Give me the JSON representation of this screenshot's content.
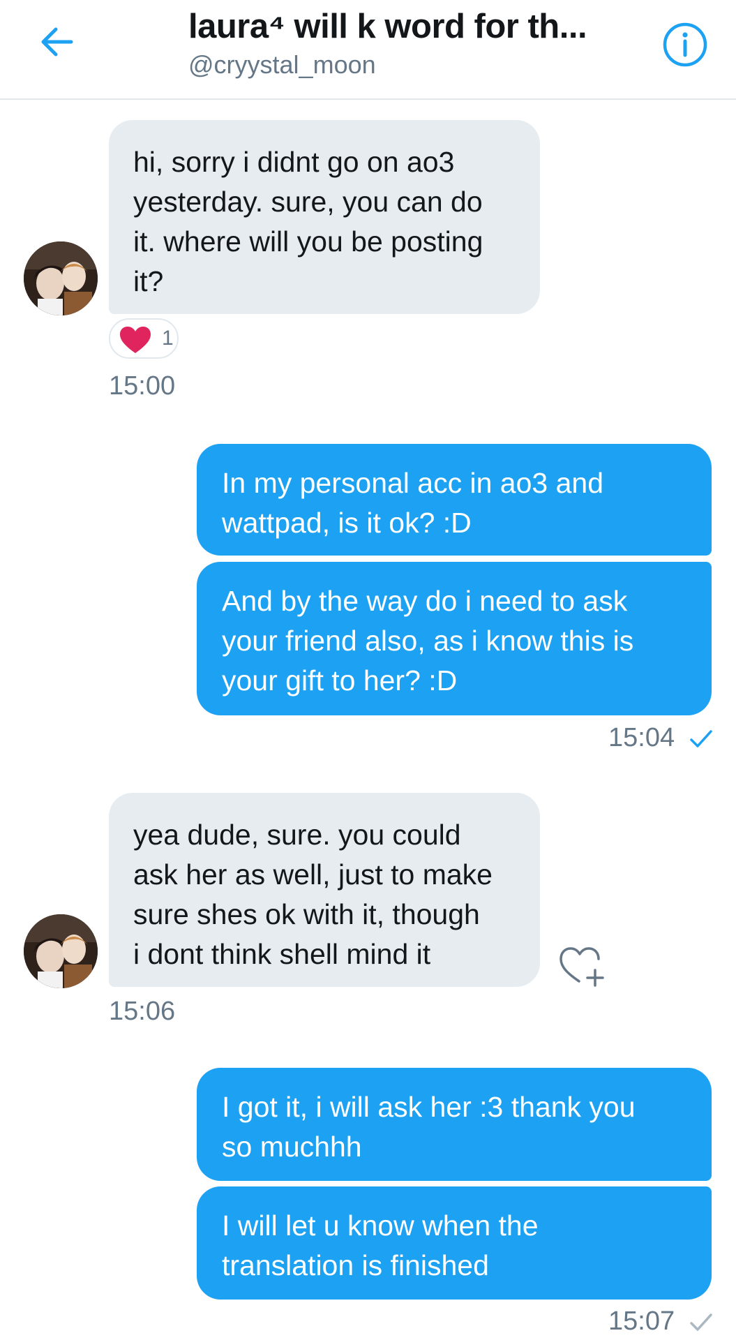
{
  "header": {
    "title": "laura⁴ will k word for th...",
    "handle": "@cryystal_moon",
    "back_icon": "arrow-left-icon",
    "info_icon": "info-icon",
    "accent_color": "#1da1f2"
  },
  "messages": [
    {
      "direction": "incoming",
      "lines": [
        "hi, sorry i didnt go on ao3",
        "yesterday. sure, you can do",
        "it. where will you be posting",
        "it?"
      ],
      "reaction": {
        "icon": "heart-icon",
        "count": "1"
      },
      "time": "15:00"
    },
    {
      "direction": "outgoing",
      "lines": [
        "In my personal acc in ao3 and",
        "wattpad, is it ok? :D"
      ]
    },
    {
      "direction": "outgoing",
      "lines": [
        "And by the way do i need to ask",
        "your friend also, as i know this is",
        "your gift to her? :D"
      ],
      "time": "15:04",
      "status": "read"
    },
    {
      "direction": "incoming",
      "lines": [
        "yea dude, sure. you could",
        "ask her as well, just to make",
        "sure shes ok with it, though",
        "i dont think shell mind it"
      ],
      "time": "15:06"
    },
    {
      "direction": "outgoing",
      "lines": [
        "I got it, i will ask her :3 thank you",
        "so muchhh"
      ]
    },
    {
      "direction": "outgoing",
      "lines": [
        "I will let u know when the",
        "translation is finished"
      ],
      "time": "15:07",
      "status": "sent"
    }
  ]
}
